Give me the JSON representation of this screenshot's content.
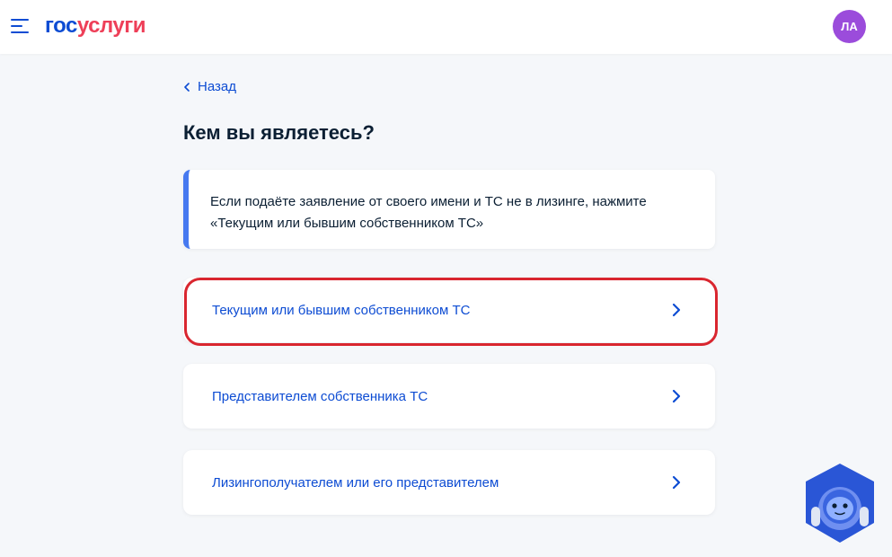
{
  "header": {
    "logo_part1": "гос",
    "logo_part2": "услуги",
    "avatar_initials": "ЛА"
  },
  "main": {
    "back_label": "Назад",
    "title": "Кем вы являетесь?",
    "info_text": "Если подаёте заявление от своего имени и ТС не в лизинге, нажмите «Текущим или бывшим собственником ТС»",
    "options": [
      {
        "label": "Текущим или бывшим собственником ТС"
      },
      {
        "label": "Представителем собственника ТС"
      },
      {
        "label": "Лизингополучателем или его представителем"
      }
    ]
  },
  "colors": {
    "brand_blue": "#0d4cd3",
    "brand_red": "#ee3f58",
    "avatar_bg": "#9b4cdb",
    "info_accent": "#4679f0",
    "highlight": "#d9262f"
  },
  "icons": [
    "menu-icon",
    "chevron-left-icon",
    "chevron-right-icon",
    "assistant-bot-icon"
  ]
}
